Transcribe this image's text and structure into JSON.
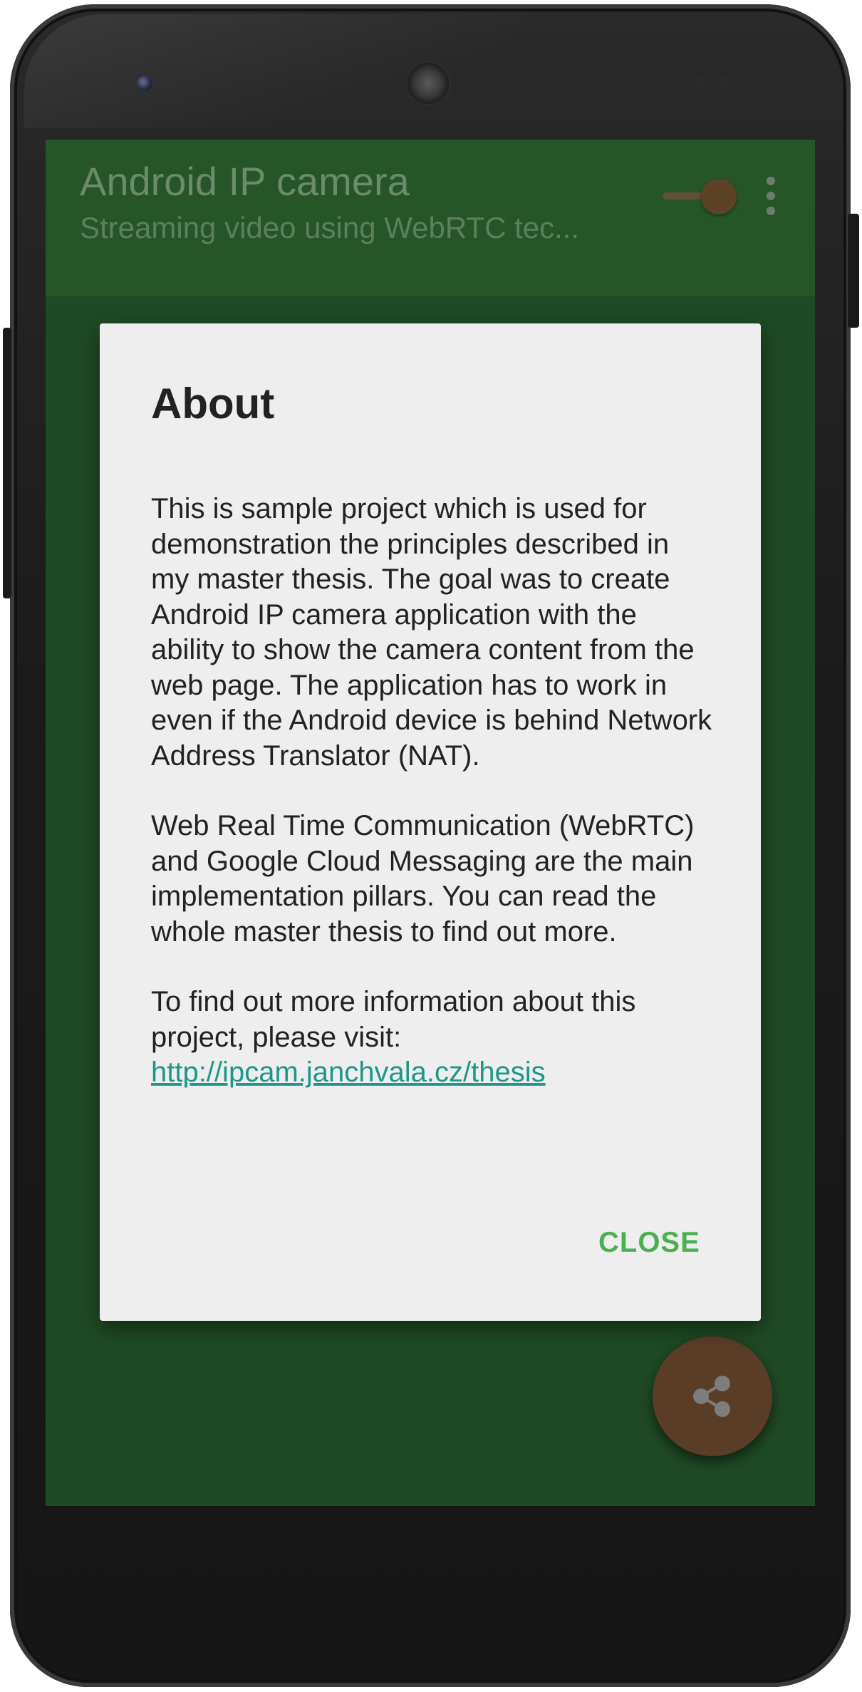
{
  "app": {
    "title": "Android IP camera",
    "subtitle": "Streaming video using WebRTC tec...",
    "switch_on": true,
    "colors": {
      "primary": "#1f4a24",
      "accent": "#4caf50",
      "fab": "#5a3d26",
      "link": "#1e968a"
    }
  },
  "dialog": {
    "title": "About",
    "paragraph1": "This is sample project which is used for demonstration the principles described in my master thesis. The goal was to create Android IP camera application with the ability to show the camera content from the web page. The application has to work in even if the Android device is behind Network Address Translator (NAT).",
    "paragraph2": "Web Real Time Communication (WebRTC) and Google Cloud Messaging are the main implementation pillars. You can read the whole master thesis to find out more.",
    "paragraph3": "To find out more information about this project, please visit:",
    "link": "http://ipcam.janchvala.cz/thesis",
    "close_label": "CLOSE"
  },
  "icons": {
    "toolbar_menu": "more-vert-icon",
    "fab": "share-icon"
  }
}
